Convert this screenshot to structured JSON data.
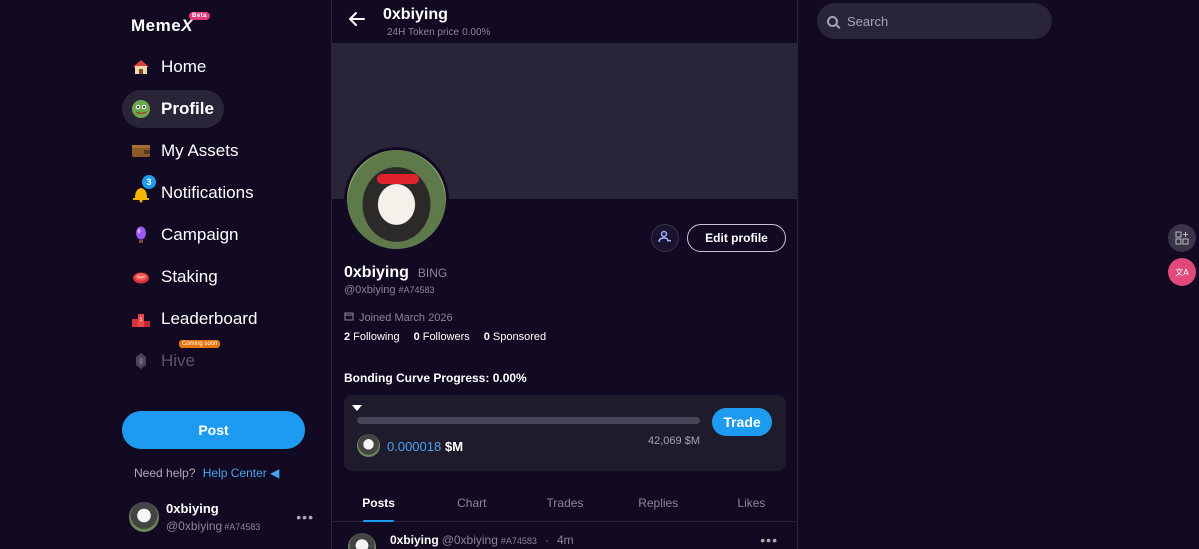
{
  "app": {
    "logo": "Meme",
    "logo_x": "X",
    "logo_badge": "Beta"
  },
  "sidebar": {
    "items": [
      {
        "label": "Home",
        "icon": "home-icon"
      },
      {
        "label": "Profile",
        "icon": "pepe-avatar-icon",
        "active": true
      },
      {
        "label": "My Assets",
        "icon": "wallet-icon"
      },
      {
        "label": "Notifications",
        "icon": "bell-icon",
        "badge": "3"
      },
      {
        "label": "Campaign",
        "icon": "balloon-icon"
      },
      {
        "label": "Staking",
        "icon": "steak-icon"
      },
      {
        "label": "Leaderboard",
        "icon": "podium-icon"
      },
      {
        "label": "Hive",
        "icon": "hive-icon",
        "tag": "Coming soon",
        "disabled": true
      }
    ],
    "post_button": "Post",
    "help_text": "Need help?",
    "help_link": "Help Center",
    "account": {
      "name": "0xbiying",
      "handle": "@0xbiying",
      "id": "#A74583"
    }
  },
  "header": {
    "title": "0xbiying",
    "subtitle_label": "24H Token price",
    "subtitle_value": "0.00%"
  },
  "profile": {
    "name": "0xbiying",
    "ticker": "BING",
    "handle": "@0xbiying",
    "id": "#A74583",
    "joined": "Joined March 2026",
    "following_count": "2",
    "following_label": "Following",
    "followers_count": "0",
    "followers_label": "Followers",
    "sponsored_count": "0",
    "sponsored_label": "Sponsored",
    "edit_button": "Edit profile"
  },
  "bonding": {
    "title": "Bonding Curve Progress: 0.00%",
    "progress": 0,
    "price": "0.000018",
    "unit": "$M",
    "market_cap": "42,069 $M",
    "trade_button": "Trade"
  },
  "tabs": [
    "Posts",
    "Chart",
    "Trades",
    "Replies",
    "Likes"
  ],
  "post": {
    "name": "0xbiying",
    "handle": "@0xbiying",
    "id": "#A74583",
    "dot": "·",
    "time": "4m"
  },
  "search": {
    "placeholder": "Search"
  },
  "colors": {
    "accent": "#1d9bf0",
    "background": "#120a22",
    "surface": "#2a2438"
  }
}
